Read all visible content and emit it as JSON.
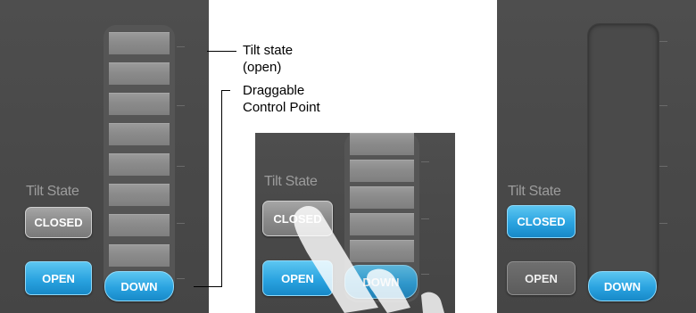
{
  "panel_open_state": {
    "tilt_state_label": "Tilt State",
    "closed_button": "CLOSED",
    "open_button": "OPEN",
    "down_button": "DOWN"
  },
  "panel_dragging": {
    "tilt_state_label": "Tilt State",
    "closed_button": "CLOSED",
    "open_button": "OPEN",
    "down_button": "DOWN"
  },
  "panel_closed_state": {
    "tilt_state_label": "Tilt State",
    "closed_button": "CLOSED",
    "open_button": "OPEN",
    "down_button": "DOWN"
  },
  "annotations": {
    "tilt_state_line1": "Tilt state",
    "tilt_state_line2": "(open)",
    "control_point_line1": "Draggable",
    "control_point_line2": "Control Point"
  },
  "colors": {
    "panel_bg": "#4b4b4b",
    "active_button": "#2aa3e0",
    "inactive_button": "#8b8b8b",
    "slat": "#8c8c8c"
  },
  "icons": {
    "hand": "pointing-hand-icon"
  }
}
